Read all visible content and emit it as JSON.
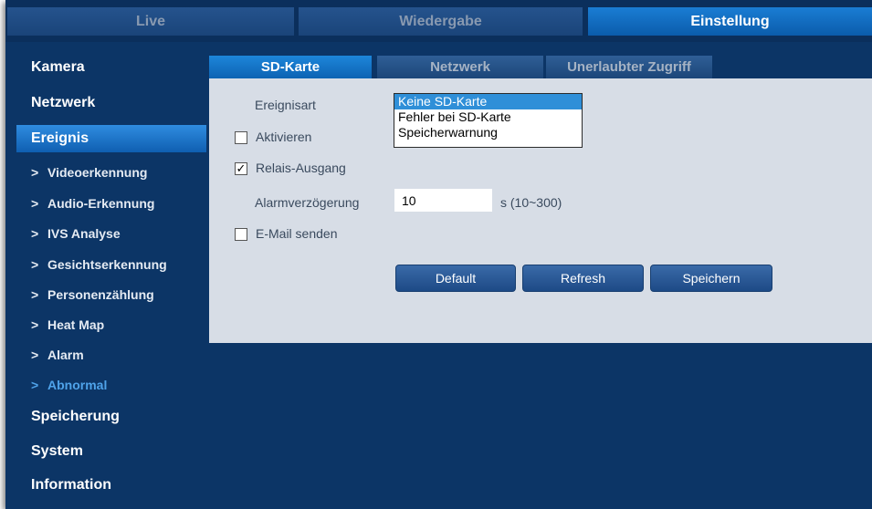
{
  "topnav": {
    "tabs": [
      "Live",
      "Wiedergabe",
      "Einstellung"
    ],
    "active": "Einstellung"
  },
  "sidebar": {
    "items": [
      "Kamera",
      "Netzwerk",
      "Ereignis"
    ],
    "sub_items": [
      "Videoerkennung",
      "Audio-Erkennung",
      "IVS Analyse",
      "Gesichtserkennung",
      "Personenzählung",
      "Heat Map",
      "Alarm",
      "Abnormal"
    ],
    "bottom_items": [
      "Speicherung",
      "System",
      "Information"
    ],
    "active_item": "Ereignis",
    "active_sub_item": "Abnormal"
  },
  "content_tabs": [
    "SD-Karte",
    "Netzwerk",
    "Unerlaubter Zugriff"
  ],
  "active_content_tab": "SD-Karte",
  "form": {
    "event_type_label": "Ereignisart",
    "event_options": [
      "Keine SD-Karte",
      "Fehler bei SD-Karte",
      "Speicherwarnung"
    ],
    "selected_event": "Keine SD-Karte",
    "enable_label": "Aktivieren",
    "enable_checked": false,
    "relay_label": "Relais-Ausgang",
    "relay_checked": true,
    "delay_label": "Alarmverzögerung",
    "delay_value": "10",
    "delay_unit": "s (10~300)",
    "email_label": "E-Mail senden",
    "email_checked": false,
    "check_mark": "✓"
  },
  "buttons": {
    "default": "Default",
    "refresh": "Refresh",
    "save": "Speichern"
  },
  "chevron": ">",
  "colors": {
    "background": "#0c3566",
    "active_tab": "#1a7dd4",
    "panel": "#d7dde6",
    "active_sub_item": "#4fa3ea",
    "selected_option": "#2f8fd8"
  }
}
